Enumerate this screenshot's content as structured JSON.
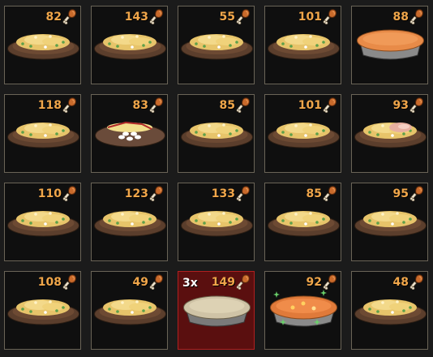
{
  "items": [
    {
      "value": "82",
      "kind": "rice"
    },
    {
      "value": "143",
      "kind": "rice"
    },
    {
      "value": "55",
      "kind": "rice"
    },
    {
      "value": "101",
      "kind": "rice"
    },
    {
      "value": "88",
      "kind": "pie"
    },
    {
      "value": "118",
      "kind": "rice"
    },
    {
      "value": "83",
      "kind": "rice-egg"
    },
    {
      "value": "85",
      "kind": "rice"
    },
    {
      "value": "101",
      "kind": "rice"
    },
    {
      "value": "93",
      "kind": "rice-meat"
    },
    {
      "value": "110",
      "kind": "rice"
    },
    {
      "value": "123",
      "kind": "rice"
    },
    {
      "value": "133",
      "kind": "rice"
    },
    {
      "value": "85",
      "kind": "rice"
    },
    {
      "value": "95",
      "kind": "rice"
    },
    {
      "value": "108",
      "kind": "rice"
    },
    {
      "value": "49",
      "kind": "rice"
    },
    {
      "value": "149",
      "kind": "pie-plain",
      "count": "3x",
      "selected": true
    },
    {
      "value": "92",
      "kind": "pie-sparkle"
    },
    {
      "value": "48",
      "kind": "rice"
    }
  ],
  "icons": {
    "value_icon": "drumstick-icon"
  },
  "colors": {
    "value_text": "#f0a64a",
    "slot_border": "#6a6457",
    "selected_bg": "#5a0f0f",
    "selected_border": "#b02020"
  }
}
